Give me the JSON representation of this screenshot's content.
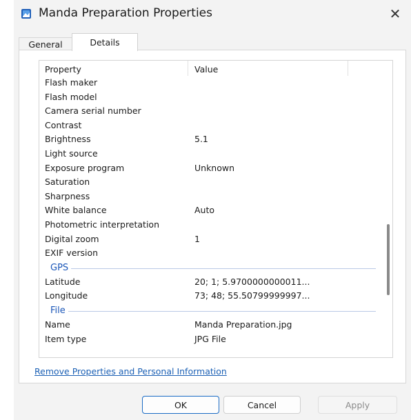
{
  "window": {
    "title": "Manda Preparation Properties",
    "close_glyph": "✕"
  },
  "tabs": [
    {
      "label": "General"
    },
    {
      "label": "Details"
    }
  ],
  "list": {
    "header": {
      "property": "Property",
      "value": "Value"
    },
    "rows_camera": [
      {
        "property": "Flash maker",
        "value": ""
      },
      {
        "property": "Flash model",
        "value": ""
      },
      {
        "property": "Camera serial number",
        "value": ""
      },
      {
        "property": "Contrast",
        "value": ""
      },
      {
        "property": "Brightness",
        "value": "5.1"
      },
      {
        "property": "Light source",
        "value": ""
      },
      {
        "property": "Exposure program",
        "value": "Unknown"
      },
      {
        "property": "Saturation",
        "value": ""
      },
      {
        "property": "Sharpness",
        "value": ""
      },
      {
        "property": "White balance",
        "value": "Auto"
      },
      {
        "property": "Photometric interpretation",
        "value": ""
      },
      {
        "property": "Digital zoom",
        "value": "1"
      },
      {
        "property": "EXIF version",
        "value": ""
      }
    ],
    "group_gps": "GPS",
    "rows_gps": [
      {
        "property": "Latitude",
        "value": "20; 1; 5.9700000000011..."
      },
      {
        "property": "Longitude",
        "value": "73; 48; 55.50799999997..."
      }
    ],
    "group_file": "File",
    "rows_file": [
      {
        "property": "Name",
        "value": "Manda Preparation.jpg"
      },
      {
        "property": "Item type",
        "value": "JPG File"
      }
    ]
  },
  "remove_link": "Remove Properties and Personal Information",
  "buttons": {
    "ok": "OK",
    "cancel": "Cancel",
    "apply": "Apply"
  },
  "colors": {
    "accent": "#1a6bc4",
    "link": "#1a5fb4",
    "group_label": "#1a56b8"
  }
}
